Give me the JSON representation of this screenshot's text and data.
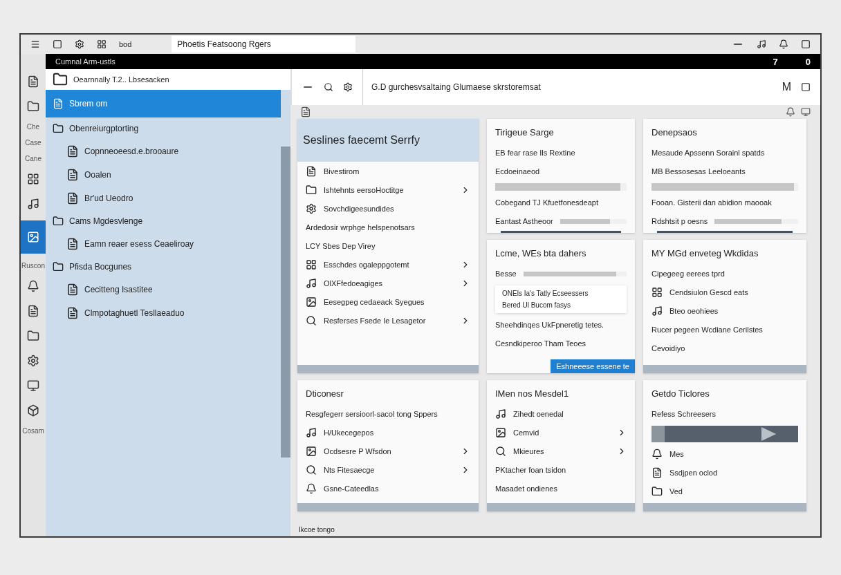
{
  "top_bar": {
    "label": "bod",
    "field": "Phoetis Featsoong Rgers"
  },
  "black_strip": {
    "title": "Cumnal Arm-ustls",
    "right_texts": [
      "7",
      "0"
    ]
  },
  "rail": [
    {
      "kind": "icon",
      "selected": false
    },
    {
      "kind": "icon",
      "selected": false
    },
    {
      "kind": "label",
      "text": "Che"
    },
    {
      "kind": "label",
      "text": "Case"
    },
    {
      "kind": "label",
      "text": "Cane"
    },
    {
      "kind": "icon",
      "selected": false
    },
    {
      "kind": "icon",
      "selected": false
    },
    {
      "kind": "icon",
      "selected": true
    },
    {
      "kind": "label",
      "text": "Ruscon"
    },
    {
      "kind": "icon",
      "selected": false
    },
    {
      "kind": "icon",
      "selected": false
    },
    {
      "kind": "icon",
      "selected": false
    },
    {
      "kind": "icon",
      "selected": false
    },
    {
      "kind": "icon",
      "selected": false
    },
    {
      "kind": "icon",
      "selected": false
    },
    {
      "kind": "label",
      "text": "Cosam"
    }
  ],
  "sidebar": {
    "header": "Oearnnally T.2.. Lbsesacken",
    "items": [
      {
        "label": "Sbrem om",
        "selected": true
      },
      {
        "label": "Obenreiurgptorting",
        "selected": false,
        "children": [
          {
            "label": "Copnneoeesd.e.brooaure",
            "selected": false
          },
          {
            "label": "Ooalen",
            "selected": false
          },
          {
            "label": "Br'ud Ueodro",
            "selected": false
          }
        ]
      },
      {
        "label": "Cams Mgdesvlenge",
        "selected": false,
        "children": [
          {
            "label": "Eamn reaer esess Ceaeliroay",
            "selected": false
          }
        ]
      },
      {
        "label": "Pfisda Bocgunes",
        "selected": false,
        "children": [
          {
            "label": "Cecitteng Isastitee",
            "selected": false
          },
          {
            "label": "Clmpotaghuetl Tesllaeaduo",
            "selected": false
          }
        ]
      }
    ]
  },
  "toolbar": {
    "address": "G.D gurchesvsaltaing Glumaese skrstoremsat",
    "right_text": "M"
  },
  "cards": [
    {
      "kind": "tall",
      "title": "Seslines faecemt Serrfy",
      "items": [
        {
          "kind": "row",
          "text": "Bivestirom",
          "chevron": false
        },
        {
          "kind": "row",
          "text": "Ishtehnts eersoHoctitge",
          "chevron": true
        },
        {
          "kind": "row",
          "text": "Sovchdigeesundides",
          "chevron": false
        },
        {
          "kind": "text",
          "text": "Ardedosir wrphge helspenotsars"
        },
        {
          "kind": "text",
          "text": "LCY Sbes Dep Virey"
        },
        {
          "kind": "row",
          "text": "Esschdes ogaleppgotemt",
          "chevron": true
        },
        {
          "kind": "row",
          "text": "OlXFfedoeagiges",
          "chevron": true
        },
        {
          "kind": "row",
          "text": "Eesegpeg cedaeack Syegues",
          "chevron": false
        },
        {
          "kind": "row",
          "text": "Resferses Fsede Ie Lesagetor",
          "chevron": true
        }
      ],
      "footer": {
        "kind": "bar"
      }
    },
    {
      "kind": "normal",
      "title": "Tirigeue Sarge",
      "items": [
        {
          "kind": "text",
          "text": "EB fear rase Ils Rextine"
        },
        {
          "kind": "text",
          "text": "Ecdoeinaeod"
        },
        {
          "kind": "bar",
          "level": 0.95
        },
        {
          "kind": "text",
          "text": "Cobegand TJ Kfuetfonesdeapt"
        },
        {
          "kind": "labelbar",
          "text": "Eantast Astheoor",
          "level": 0.75
        }
      ],
      "footer": {
        "kind": "line"
      }
    },
    {
      "kind": "normal",
      "title": "Denepsaos",
      "items": [
        {
          "kind": "text",
          "text": "Mesaude Apssenn Sorainl spatds"
        },
        {
          "kind": "text",
          "text": "MB Bessosesas Leeloeants"
        },
        {
          "kind": "bar",
          "level": 0.97
        },
        {
          "kind": "text",
          "text": "Fooan. Gisterii dan abidion maooak"
        },
        {
          "kind": "labelbar",
          "text": "Rdshtsit p oesns",
          "level": 0.8
        }
      ],
      "footer": {
        "kind": "line"
      }
    },
    {
      "kind": "normal",
      "title": "Lcme, WEs bta dahers",
      "items": [
        {
          "kind": "labelbar",
          "text": "Besse",
          "level": 0.9
        },
        {
          "kind": "box",
          "lines": [
            "ONEls Ia's Tatly Ecseessers",
            "Bered Ul Bucom fasys"
          ]
        },
        {
          "kind": "text",
          "text": "Sheehdinqes UkFpneretig tetes."
        },
        {
          "kind": "text",
          "text": "Cesndkiperoo Tham Teoes"
        }
      ],
      "footer": {
        "kind": "button",
        "text": "Eshneeese essene te"
      }
    },
    {
      "kind": "normal",
      "title": "MY MGd enveteg Wkdidas",
      "items": [
        {
          "kind": "text",
          "text": "Cipegeeg eerees tprd"
        },
        {
          "kind": "row",
          "text": "Cendsiulon Gescd eats",
          "chevron": false
        },
        {
          "kind": "row",
          "text": "Bteo oeohiees",
          "chevron": false
        },
        {
          "kind": "text",
          "text": "Rucer pegeen Wcdiane Cerilstes"
        },
        {
          "kind": "text",
          "text": "Cevoidiyo"
        }
      ],
      "footer": {
        "kind": "bar"
      }
    },
    {
      "kind": "normal",
      "title": "Dticonesr",
      "items": [
        {
          "kind": "text",
          "text": "Resgfegerr sersioorl-sacol tong Sppers"
        },
        {
          "kind": "row",
          "text": "H/Ukecegepos",
          "chevron": false
        },
        {
          "kind": "row",
          "text": "Ocdsesre P Wfsdon",
          "chevron": true
        },
        {
          "kind": "row",
          "text": "Nts Fitesaecge",
          "chevron": true
        },
        {
          "kind": "row",
          "text": "Gsne-Cateedlas",
          "chevron": false
        }
      ],
      "footer": {
        "kind": "bar"
      }
    },
    {
      "kind": "normal",
      "title": "IMen nos Mesdel1",
      "items": [
        {
          "kind": "row",
          "text": "Zihedt oenedal",
          "chevron": false
        },
        {
          "kind": "row",
          "text": "Cemvid",
          "chevron": true
        },
        {
          "kind": "row",
          "text": "Mkieures",
          "chevron": true
        },
        {
          "kind": "text",
          "text": "PKtacher foan tsidon"
        },
        {
          "kind": "text",
          "text": "Masadet ondienes"
        }
      ],
      "footer": {
        "kind": "bar"
      }
    },
    {
      "kind": "normal",
      "title": "Getdo Ticlores",
      "items": [
        {
          "kind": "text",
          "text": "Refess Schreesers"
        },
        {
          "kind": "banner"
        },
        {
          "kind": "row",
          "text": "Mes",
          "chevron": false
        },
        {
          "kind": "row",
          "text": "Ssdjpen oclod",
          "chevron": false
        },
        {
          "kind": "row",
          "text": "Ved",
          "chevron": false
        }
      ],
      "footer": {
        "kind": "bar"
      }
    }
  ],
  "status_bar": {
    "text": "Ikcoe tongo"
  }
}
